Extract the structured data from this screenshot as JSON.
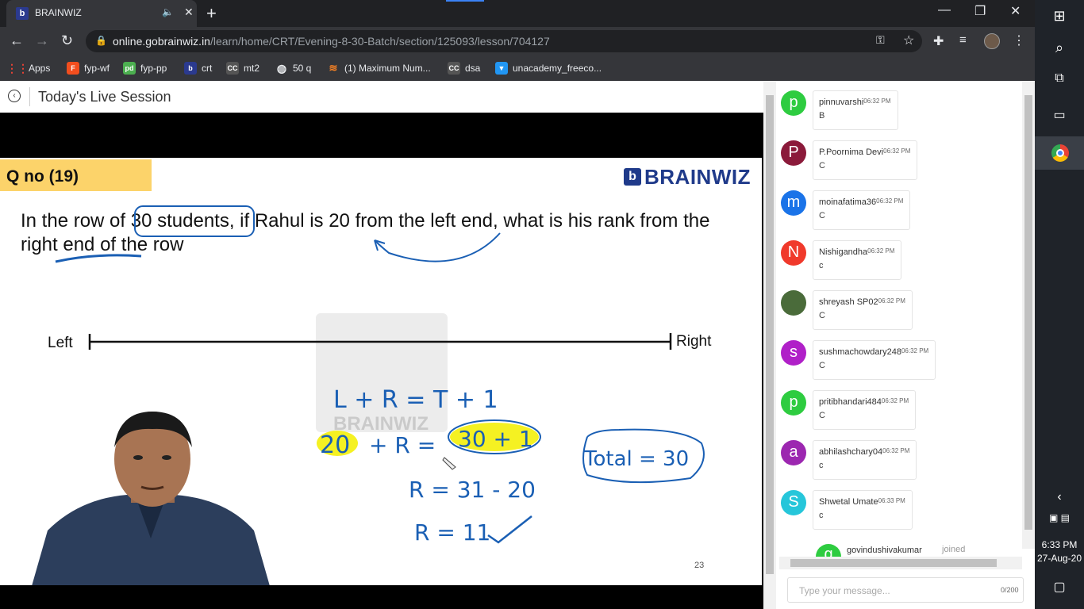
{
  "browser": {
    "tab_title": "BRAINWIZ",
    "tab_favicon": "b",
    "url_host": "online.gobrainwiz.in",
    "url_path": "/learn/home/CRT/Evening-8-30-Batch/section/125093/lesson/704127"
  },
  "bookmarks": [
    {
      "label": "Apps",
      "icon": "grid-icon",
      "color": "#e94235"
    },
    {
      "label": "fyp-wf",
      "icon": "figma-icon",
      "color": "#f24e1e"
    },
    {
      "label": "fyp-pp",
      "icon": "pd-icon",
      "color": "#4caf50"
    },
    {
      "label": "crt",
      "icon": "b-icon",
      "color": "#2b3a8f"
    },
    {
      "label": "mt2",
      "icon": "cc-icon",
      "color": "#555555"
    },
    {
      "label": "50 q",
      "icon": "globe-icon",
      "color": "#e8eaed"
    },
    {
      "label": "(1) Maximum Num...",
      "icon": "stack-icon",
      "color": "#f48024"
    },
    {
      "label": "dsa",
      "icon": "cc-icon",
      "color": "#555555"
    },
    {
      "label": "unacademy_freeco...",
      "icon": "drop-icon",
      "color": "#2196f3"
    }
  ],
  "session": {
    "title": "Today's Live Session"
  },
  "slide": {
    "qno": "Q no (19)",
    "logo": "BRAINWIZ",
    "question": "In the row of 30 students, if Rahul is 20 from the left end, what is his rank from the right end of the row",
    "label_left": "Left",
    "label_right": "Right",
    "watermark": "BRAINWIZ",
    "page": "23",
    "hw_line1": "L + R = T + 1",
    "hw_line2a": "20",
    "hw_line2b": "+ R =",
    "hw_line2c": "30 + 1",
    "hw_line3": "R = 31 - 20",
    "hw_line4": "R = 11",
    "hw_total": "Total = 30",
    "accent_color": "#fcd36a",
    "ink_color": "#1a5fb4"
  },
  "chat": {
    "messages": [
      {
        "name": "pinnuvarshi",
        "time": "06:32 PM",
        "text": "B",
        "initial": "p",
        "color": "#2ecc40"
      },
      {
        "name": "P.Poornima Devi",
        "time": "06:32 PM",
        "text": "C",
        "initial": "P",
        "color": "#8b1a3a"
      },
      {
        "name": "moinafatima36",
        "time": "06:32 PM",
        "text": "C",
        "initial": "m",
        "color": "#1a73e8"
      },
      {
        "name": "Nishigandha",
        "time": "06:32 PM",
        "text": "c",
        "initial": "N",
        "color": "#f0392b"
      },
      {
        "name": "shreyash SP02",
        "time": "06:32 PM",
        "text": "C",
        "initial": "",
        "color": "#4a6b3a"
      },
      {
        "name": "sushmachowdary248",
        "time": "06:32 PM",
        "text": "C",
        "initial": "s",
        "color": "#b020c8"
      },
      {
        "name": "pritibhandari484",
        "time": "06:32 PM",
        "text": "C",
        "initial": "p",
        "color": "#2ecc40"
      },
      {
        "name": "abhilashchary04",
        "time": "06:32 PM",
        "text": "c",
        "initial": "a",
        "color": "#9c27b0"
      },
      {
        "name": "Shwetal Umate",
        "time": "06:33 PM",
        "text": "c",
        "initial": "S",
        "color": "#26c6da"
      }
    ],
    "joined_name": "govindushivakumar",
    "joined_text": "joined",
    "joined_initial": "g",
    "input_placeholder": "Type your message...",
    "char_count": "0/200"
  },
  "taskbar": {
    "time": "6:33 PM",
    "date": "27-Aug-20"
  }
}
